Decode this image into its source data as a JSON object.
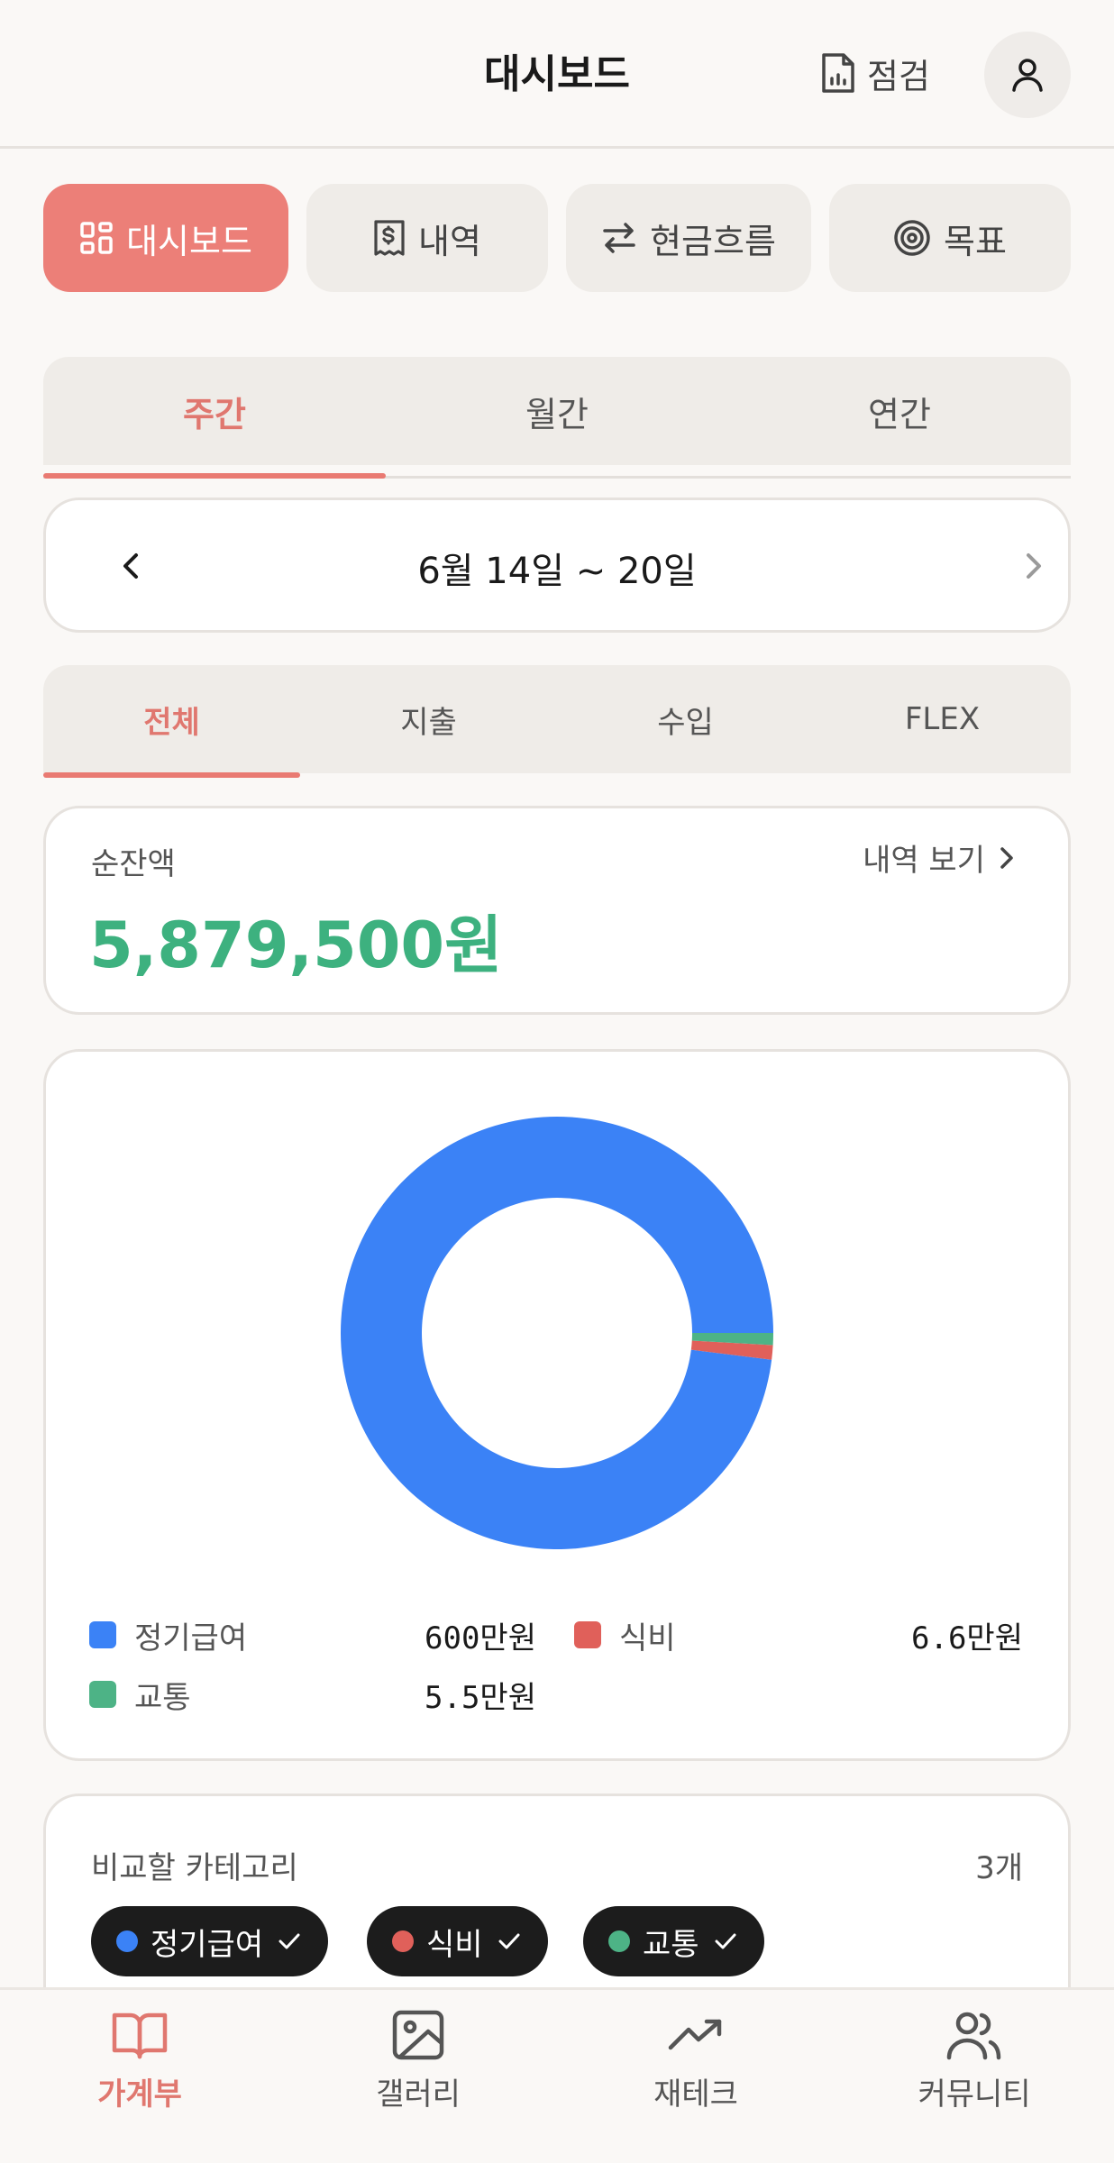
{
  "header": {
    "title": "대시보드",
    "check_label": "점검"
  },
  "main_tabs": [
    {
      "label": "대시보드",
      "icon": "dashboard-icon",
      "active": true
    },
    {
      "label": "내역",
      "icon": "receipt-icon",
      "active": false
    },
    {
      "label": "현금흐름",
      "icon": "transfer-icon",
      "active": false
    },
    {
      "label": "목표",
      "icon": "target-icon",
      "active": false
    }
  ],
  "period_tabs": [
    {
      "label": "주간",
      "active": true
    },
    {
      "label": "월간",
      "active": false
    },
    {
      "label": "연간",
      "active": false
    }
  ],
  "date_range": "6월 14일 ~ 20일",
  "filter_tabs": [
    {
      "label": "전체",
      "active": true
    },
    {
      "label": "지출",
      "active": false
    },
    {
      "label": "수입",
      "active": false
    },
    {
      "label": "FLEX",
      "active": false
    }
  ],
  "net_balance": {
    "label": "순잔액",
    "link": "내역 보기",
    "amount": "5,879,500원"
  },
  "chart_data": {
    "type": "pie",
    "donut": true,
    "categories": [
      "정기급여",
      "식비",
      "교통"
    ],
    "values": [
      6000000,
      66000,
      55000
    ],
    "value_labels": [
      "600만원",
      "6.6만원",
      "5.5만원"
    ],
    "colors": [
      "#3b82f6",
      "#e0605a",
      "#4db386"
    ],
    "legend_position": "bottom"
  },
  "compare": {
    "title": "비교할 카테고리",
    "count": "3개",
    "chips": [
      {
        "label": "정기급여",
        "color": "#3b82f6"
      },
      {
        "label": "식비",
        "color": "#e0605a"
      },
      {
        "label": "교통",
        "color": "#4db386"
      }
    ]
  },
  "bottom_nav": [
    {
      "label": "가계부",
      "icon": "book-icon",
      "active": true
    },
    {
      "label": "갤러리",
      "icon": "image-icon",
      "active": false
    },
    {
      "label": "재테크",
      "icon": "trend-up-icon",
      "active": false
    },
    {
      "label": "커뮤니티",
      "icon": "users-icon",
      "active": false
    }
  ]
}
